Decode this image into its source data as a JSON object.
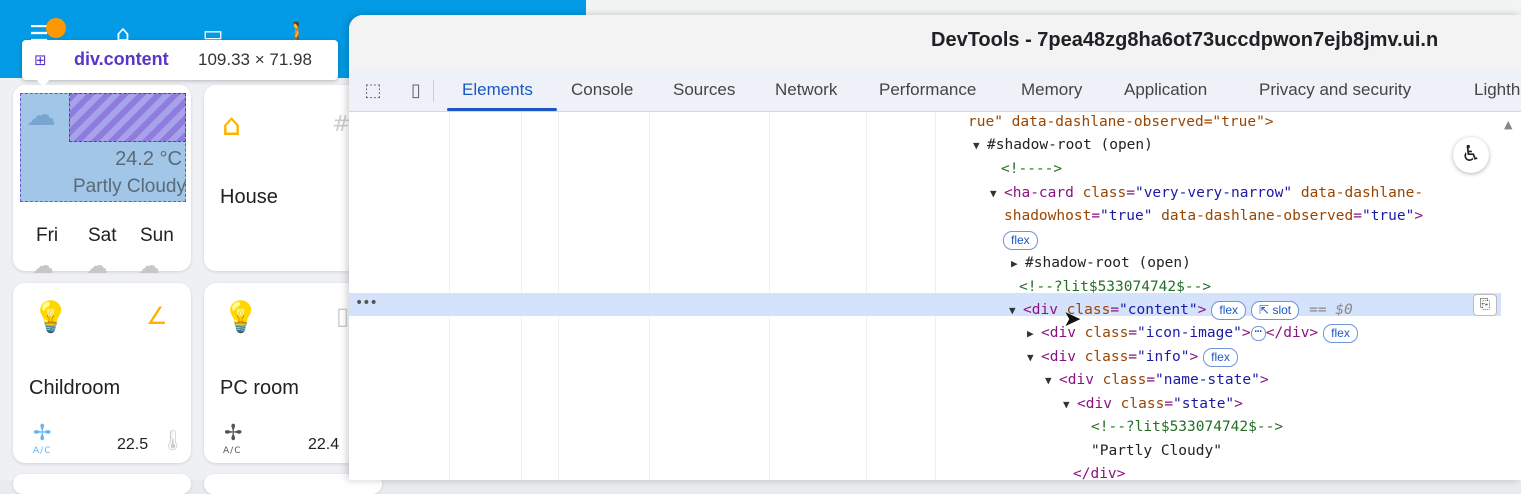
{
  "tooltip": {
    "selector": "div.content",
    "dimensions": "109.33 × 71.98"
  },
  "dashboard": {
    "weather": {
      "temperature": "24.2 °C",
      "condition": "Partly Cloudy",
      "forecast_days": [
        "Fri",
        "Sat",
        "Sun"
      ]
    },
    "cards": [
      {
        "title": "House",
        "icon": "home-icon"
      },
      {
        "title": "Childroom",
        "icon": "bulb-icon",
        "value": "22.5",
        "mode": "A/C"
      },
      {
        "title": "PC room",
        "icon": "bulb-icon",
        "value": "22.4",
        "mode": "A/C"
      }
    ]
  },
  "devtools": {
    "title": "DevTools - 7pea48zg8ha6ot73uccdpwon7ejb8jmv.ui.n",
    "tabs": [
      "Elements",
      "Console",
      "Sources",
      "Network",
      "Performance",
      "Memory",
      "Application",
      "Privacy and security",
      "Lighth"
    ],
    "active_tab": "Elements",
    "selected_suffix": "== $0",
    "tree": {
      "l1": {
        "text": "rue\" data-dashlane-observed=\"true\">"
      },
      "l2": {
        "text": "#shadow-root (open)"
      },
      "l3": {
        "text": "<!---->"
      },
      "l4": {
        "tag_open": "<ha-card",
        "attr1": "class",
        "val1": "\"very-very-narrow\"",
        "attr2": "data-dashlane-"
      },
      "l5": {
        "attr1": "shadowhost",
        "val1": "\"true\"",
        "attr2": "data-dashlane-observed",
        "val2": "\"true\"",
        "close": ">"
      },
      "l6": {
        "badge": "flex"
      },
      "l7": {
        "text": "#shadow-root (open)"
      },
      "l8": {
        "text": "<!--?lit$533074742$-->"
      },
      "l9": {
        "tag_open": "<div",
        "attr": "class",
        "val": "\"content\"",
        "close": ">",
        "badge1": "flex",
        "badge2": "slot"
      },
      "l10": {
        "tag_open": "<div",
        "attr": "class",
        "val": "\"icon-image\"",
        "close": ">",
        "ellipsis": "⋯",
        "end": "</div>",
        "badge": "flex"
      },
      "l11": {
        "tag_open": "<div",
        "attr": "class",
        "val": "\"info\"",
        "close": ">",
        "badge": "flex"
      },
      "l12": {
        "tag_open": "<div",
        "attr": "class",
        "val": "\"name-state\"",
        "close": ">"
      },
      "l13": {
        "tag_open": "<div",
        "attr": "class",
        "val": "\"state\"",
        "close": ">"
      },
      "l14": {
        "text": "<!--?lit$533074742$-->"
      },
      "l15": {
        "text": "\"Partly Cloudy\""
      },
      "l16": {
        "text": "</div>"
      }
    }
  }
}
